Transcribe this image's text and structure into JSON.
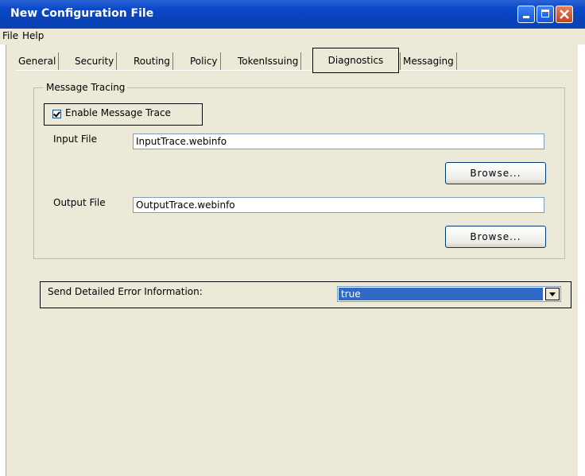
{
  "window": {
    "title": "New Configuration File"
  },
  "menu": {
    "items": [
      "File",
      "Help"
    ]
  },
  "tabs": [
    {
      "label": "General",
      "active": false
    },
    {
      "label": "Security",
      "active": false
    },
    {
      "label": "Routing",
      "active": false
    },
    {
      "label": "Policy",
      "active": false
    },
    {
      "label": "TokenIssuing",
      "active": false
    },
    {
      "label": "Diagnostics",
      "active": true
    },
    {
      "label": "Messaging",
      "active": false
    }
  ],
  "tracing": {
    "group_label": "Message Tracing",
    "enable_label": "Enable Message Trace",
    "enabled": true,
    "input_label": "Input File",
    "input_value": "InputTrace.webinfo",
    "output_label": "Output File",
    "output_value": "OutputTrace.webinfo",
    "browse_label": "Browse..."
  },
  "errors": {
    "label": "Send Detailed Error Information:",
    "selected": "true"
  },
  "colors": {
    "titlebar": "#0a49c8",
    "selection": "#316ac5",
    "panel": "#ece9d8"
  }
}
